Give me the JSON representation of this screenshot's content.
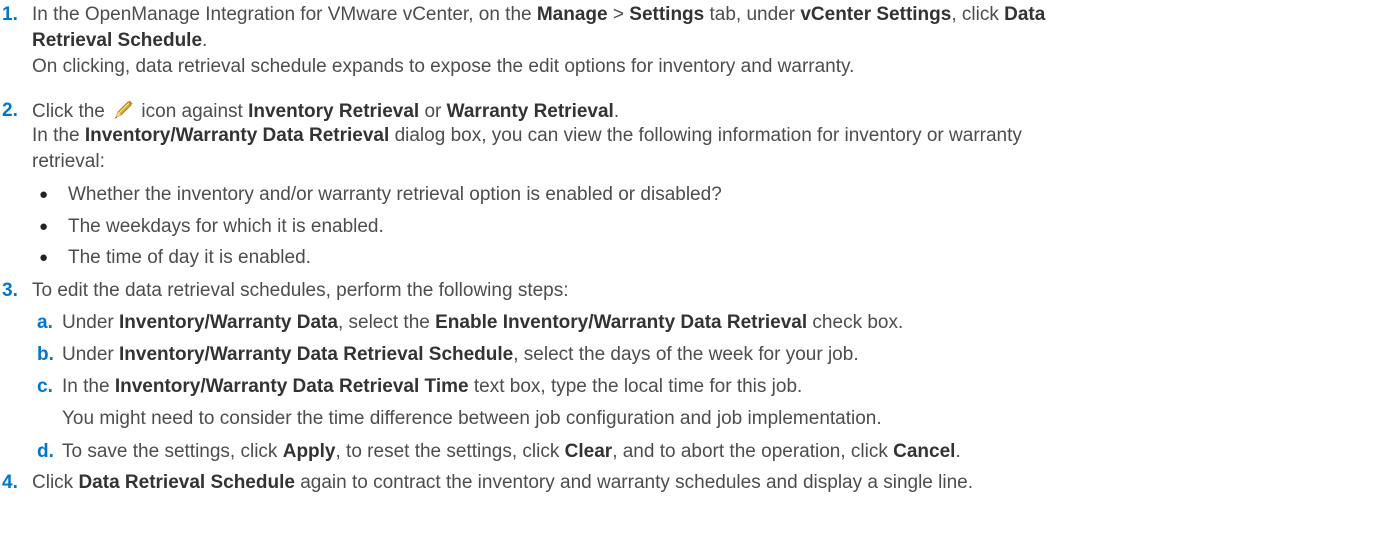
{
  "steps": [
    {
      "number": "1.",
      "line1": {
        "a": "In the OpenManage Integration for VMware vCenter, on the ",
        "b1": "Manage",
        "c": " > ",
        "b2": "Settings",
        "d": " tab, under ",
        "b3": "vCenter Settings",
        "e": ", click ",
        "b4": "Data"
      },
      "line2": {
        "b": "Retrieval Schedule",
        "c": "."
      },
      "line3": "On clicking, data retrieval schedule expands to expose the edit options for inventory and warranty."
    },
    {
      "number": "2.",
      "line1": {
        "a": "Click the ",
        "icon": "pencil-icon",
        "b": " icon against ",
        "b1": "Inventory Retrieval",
        "c": " or ",
        "b2": "Warranty Retrieval",
        "d": "."
      },
      "line2": {
        "a": "In the ",
        "b1": "Inventory/Warranty Data Retrieval",
        "c": " dialog box, you can view the following information for inventory or warranty"
      },
      "line3": "retrieval:",
      "bullets": [
        "Whether the inventory and/or warranty retrieval option is enabled or disabled?",
        "The weekdays for which it is enabled.",
        "The time of day it is enabled."
      ]
    },
    {
      "number": "3.",
      "text": "To edit the data retrieval schedules, perform the following steps:",
      "substeps": [
        {
          "letter": "a.",
          "a": "Under ",
          "b1": "Inventory/Warranty Data",
          "c": ", select the ",
          "b2": "Enable Inventory/Warranty Data Retrieval",
          "d": " check box."
        },
        {
          "letter": "b.",
          "a": "Under ",
          "b1": "Inventory/Warranty Data Retrieval Schedule",
          "c": ", select the days of the week for your job."
        },
        {
          "letter": "c.",
          "a": "In the ",
          "b1": "Inventory/Warranty Data Retrieval Time",
          "c": " text box, type the local time for this job.",
          "note": "You might need to consider the time difference between job configuration and job implementation."
        },
        {
          "letter": "d.",
          "a": "To save the settings, click ",
          "b1": "Apply",
          "c": ", to reset the settings, click ",
          "b2": "Clear",
          "d": ", and to abort the operation, click ",
          "b3": "Cancel",
          "e": "."
        }
      ]
    },
    {
      "number": "4.",
      "a": "Click ",
      "b1": "Data Retrieval Schedule",
      "c": " again to contract the inventory and warranty schedules and display a single line."
    }
  ],
  "colors": {
    "step_number": "#0076ce",
    "body_text": "#4d4d4d",
    "pencil": "#d9a52a"
  }
}
